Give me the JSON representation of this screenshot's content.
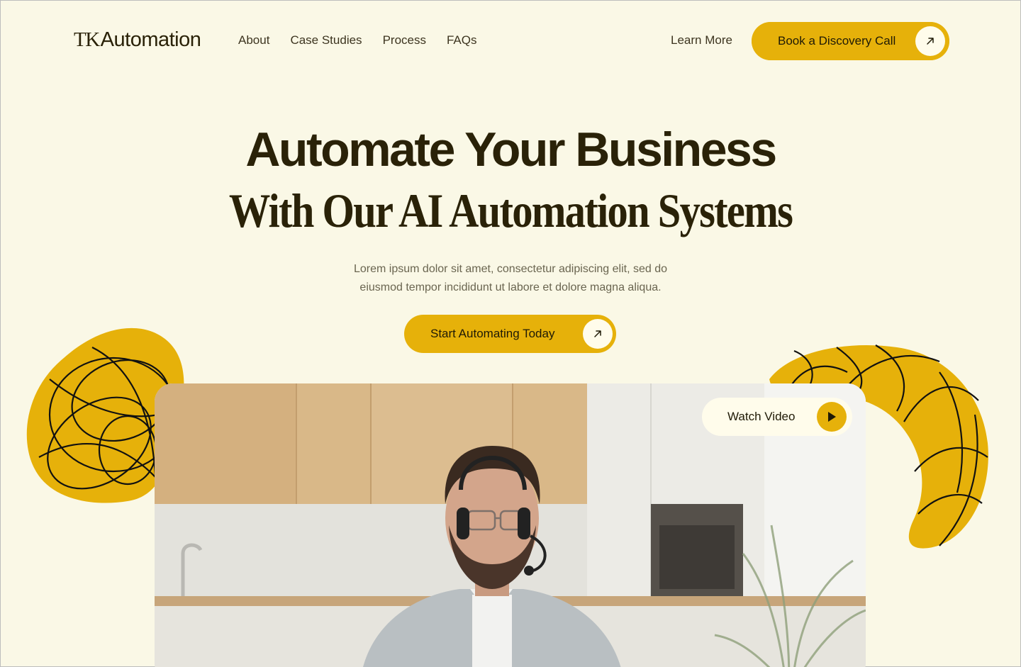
{
  "nav": {
    "logo_mark": "TK",
    "logo_word": "Automation",
    "links": [
      "About",
      "Case Studies",
      "Process",
      "FAQs"
    ],
    "learn_more": "Learn More",
    "book_call": "Book a Discovery Call"
  },
  "hero": {
    "title_line1": "Automate Your Business",
    "title_line2": "With Our AI Automation Systems",
    "lead_line1": "Lorem ipsum dolor sit amet, consectetur adipiscing elit, sed do",
    "lead_line2": "eiusmod tempor incididunt ut labore et dolore magna aliqua.",
    "cta": "Start Automating Today"
  },
  "video": {
    "watch_label": "Watch Video"
  },
  "colors": {
    "background": "#FAF8E6",
    "accent": "#E6B10A",
    "text": "#2A2208",
    "pill_light": "#FFFCEB"
  },
  "icons": {
    "cta_arrow": "arrow-up-right-icon",
    "play": "play-icon"
  }
}
